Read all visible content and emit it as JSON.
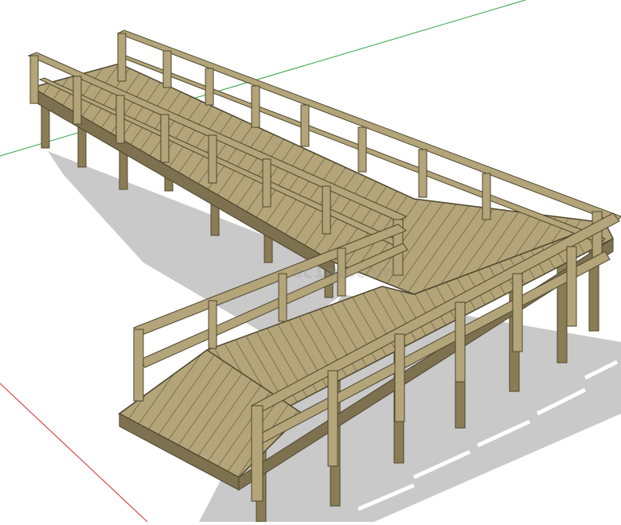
{
  "scene": {
    "subject": "wooden-boardwalk-3d-model",
    "colors": {
      "wood": "#a89a6e",
      "wood_light": "#c2b488",
      "wood_dark": "#5a5238",
      "shadow": "#c4c4c4",
      "axis_green": "#2ea043",
      "axis_red": "#d62828",
      "background": "#ffffff"
    }
  },
  "watermark": {
    "text": "sc1ab.com"
  }
}
